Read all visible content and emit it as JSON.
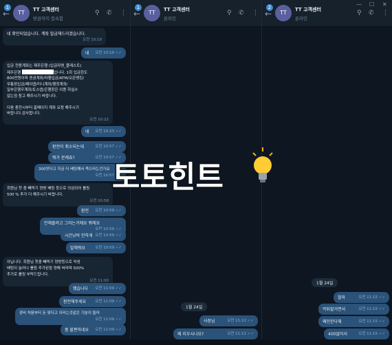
{
  "panels": [
    {
      "badge": "1",
      "avatar": "TT",
      "title": "TT 고객센터",
      "status": "방금까지 접속함",
      "messages": [
        {
          "text": "네 확인되었습니다. 계좌 발급해드리겠습니다.",
          "time": "오전 10:19"
        },
        {
          "text": "네",
          "time": "오전 10:19"
        },
        {
          "text_a": "입금 전용계좌는 제주은행 (입금자명_플레스트)\n제주은행 ",
          "text_b": "입니다. 1회 입금한도\n800만원이며 증권계좌/타행입금/ATM/오픈뱅킹/\n무통장입금/페이앱/미니계좌/행정계좌/\n일부은행우계좌/토스앱/은행창은 이용 하실수\n없는점 참고 해주시기 바랍니다.\n\n다음 충전시부터 홈페이지 계좌 요청 해주시기\n바랍니다.감사합니다.",
          "time": "오전 10:22"
        },
        {
          "text": "네",
          "time": "오전 10:23"
        },
        {
          "text": "환전이 취소되는데",
          "time": "오전 10:57"
        },
        {
          "text": "뭐가 문제죠?",
          "time": "오전 10:57"
        },
        {
          "text": "300맛다고 지금 더 배팅해서 죽으라는건가요",
          "time": "오전 10:57"
        },
        {
          "text": "회원님 첫 충 빼먹기 양방 배팅 등으로 의심되어 롤링\n500 % 추가 더 해주시기 바랍니다.",
          "time": "오전 10:58"
        },
        {
          "text": "환전",
          "time": "오전 10:59"
        },
        {
          "text": "안해줄려고 그러는거에요 뭐에요",
          "time": "오전 10:59"
        },
        {
          "text": "시간낭비 안하게",
          "time": "오전 10:59"
        },
        {
          "text": "말해줘요",
          "time": "오전 10:59"
        },
        {
          "text": "아닙니다. 회원님 첫충 빼먹기 양방등으로 악성\n배팅이 늘어나 롤링 추가된점 양해 바라며 500%\n추가로 롤링 부탁드립니다.",
          "time": "오전 11:00"
        },
        {
          "text": "했습니다",
          "time": "오전 11:09"
        },
        {
          "text": "환전해주세요",
          "time": "오전 11:09"
        },
        {
          "text": "광비 처음부터 돈 맞다고 이러는것같은 기분이 들어",
          "time": "오전 11:09"
        },
        {
          "text": "좀 불편하네요",
          "time": "오전 11:09"
        }
      ]
    },
    {
      "badge": "1",
      "avatar": "TT",
      "title": "TT 고객센터",
      "status": "온라인",
      "date": "1월 24일",
      "messages": [
        {
          "text": "사장님",
          "time": "오전 11:12"
        },
        {
          "text": "왜 지우시나요?",
          "time": "오전 11:12"
        }
      ]
    },
    {
      "badge": "2",
      "avatar": "TT",
      "title": "TT 고객센터",
      "status": "온라인",
      "date": "1월 24일",
      "messages": [
        {
          "text": "왈마",
          "time": "오전 11:15"
        },
        {
          "text": "먹튀할거면서",
          "time": "오전 11:15"
        },
        {
          "text": "왜인한다해",
          "time": "오전 11:15"
        },
        {
          "text": "400없어서",
          "time": "오전 11:15"
        }
      ]
    }
  ],
  "watermark": {
    "text": "토토힌트"
  },
  "colors": {
    "bg": "#0e1621",
    "header": "#17212b",
    "incoming": "#182533",
    "outgoing": "#2b5278",
    "accent": "#3d8ed6"
  },
  "icons": [
    "back-arrow-icon",
    "search-icon",
    "call-icon",
    "more-icon",
    "double-check-icon",
    "lightbulb-icon",
    "minimize-icon",
    "maximize-icon",
    "close-icon"
  ]
}
